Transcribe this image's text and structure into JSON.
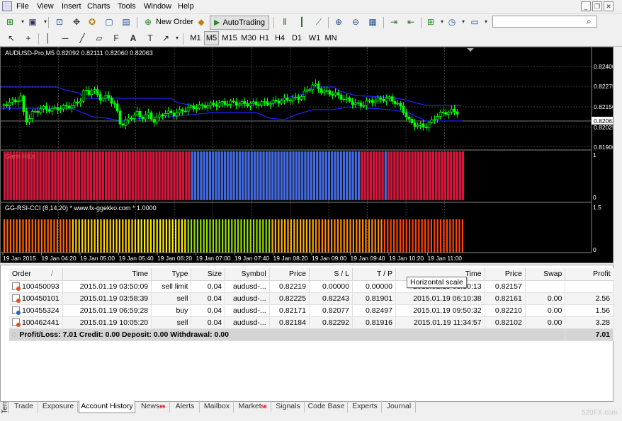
{
  "menu": [
    "File",
    "View",
    "Insert",
    "Charts",
    "Tools",
    "Window",
    "Help"
  ],
  "toolbar": {
    "new_order": "New Order",
    "autotrading": "AutoTrading",
    "search_placeholder": ""
  },
  "timeframes": [
    "M1",
    "M5",
    "M15",
    "M30",
    "H1",
    "H4",
    "D1",
    "W1",
    "MN"
  ],
  "active_timeframe": "M5",
  "chart": {
    "header": "AUDUSD-Pro,M5  0.82092 0.82111 0.82060 0.82063",
    "price_labels": [
      "0.82400",
      "0.82275",
      "0.82150",
      "0.82063",
      "0.82025",
      "0.81900"
    ],
    "current_price": "0.82063",
    "time_labels": [
      "19 Jan 2015",
      "19 Jan 04:20",
      "19 Jan 05:00",
      "19 Jan 05:40",
      "19 Jan 06:20",
      "19 Jan 07:00",
      "19 Jan 07:40",
      "19 Jan 08:20",
      "19 Jan 09:00",
      "19 Jan 09:40",
      "19 Jan 10:20",
      "19 Jan 11:00"
    ],
    "gann_label": "Gann HiLo",
    "gann_scale": [
      "1",
      "0"
    ],
    "rsi_label": "GG-RSI-CCI (8,14,20) * www.fx-ggekko.com *  1.0000",
    "rsi_scale": [
      "1.5",
      "0"
    ],
    "colors": {
      "bull": "#00ff00",
      "bear": "#00ff00",
      "band": "#2020ff",
      "gann_red": "#dc143c",
      "gann_blue": "#4169e1",
      "bg": "#000000"
    }
  },
  "terminal": {
    "columns": [
      "Order",
      "/",
      "Time",
      "Type",
      "Size",
      "Symbol",
      "Price",
      "S / L",
      "T / P",
      "Time",
      "Price",
      "Swap",
      "Profit"
    ],
    "rows": [
      {
        "order": "100450093",
        "time": "2015.01.19 03:50:09",
        "type": "sell limit",
        "size": "0.04",
        "symbol": "audusd-...",
        "price": "0.82219",
        "sl": "0.00000",
        "tp": "0.00000",
        "ctime": "2015.01.19 03:50:13",
        "cprice": "0.82157",
        "swap": "",
        "profit": ""
      },
      {
        "order": "100450101",
        "time": "2015.01.19 03:58:39",
        "type": "sell",
        "size": "0.04",
        "symbol": "audusd-...",
        "price": "0.82225",
        "sl": "0.82243",
        "tp": "0.81901",
        "ctime": "2015.01.19 06:10:38",
        "cprice": "0.82161",
        "swap": "0.00",
        "profit": "2.56"
      },
      {
        "order": "100455324",
        "time": "2015.01.19 06:59:28",
        "type": "buy",
        "size": "0.04",
        "symbol": "audusd-...",
        "price": "0.82171",
        "sl": "0.82077",
        "tp": "0.82497",
        "ctime": "2015.01.19 09:50:32",
        "cprice": "0.82210",
        "swap": "0.00",
        "profit": "1.56"
      },
      {
        "order": "100462441",
        "time": "2015.01.19 10:05:20",
        "type": "sell",
        "size": "0.04",
        "symbol": "audusd-...",
        "price": "0.82184",
        "sl": "0.82292",
        "tp": "0.81916",
        "ctime": "2015.01.19 11:34:57",
        "cprice": "0.82102",
        "swap": "0.00",
        "profit": "3.28"
      }
    ],
    "summary": "Profit/Loss: 7.01  Credit: 0.00  Deposit: 0.00  Withdrawal: 0.00",
    "summary_profit": "7.01",
    "tooltip": "Horizontal scale",
    "side_label": "Terminal",
    "tabs": [
      {
        "label": "Trade",
        "badge": ""
      },
      {
        "label": "Exposure",
        "badge": ""
      },
      {
        "label": "Account History",
        "badge": ""
      },
      {
        "label": "News",
        "badge": "99"
      },
      {
        "label": "Alerts",
        "badge": ""
      },
      {
        "label": "Mailbox",
        "badge": ""
      },
      {
        "label": "Market",
        "badge": "58"
      },
      {
        "label": "Signals",
        "badge": ""
      },
      {
        "label": "Code Base",
        "badge": ""
      },
      {
        "label": "Experts",
        "badge": ""
      },
      {
        "label": "Journal",
        "badge": ""
      }
    ],
    "active_tab": "Account History"
  },
  "watermark": "520FX.com"
}
